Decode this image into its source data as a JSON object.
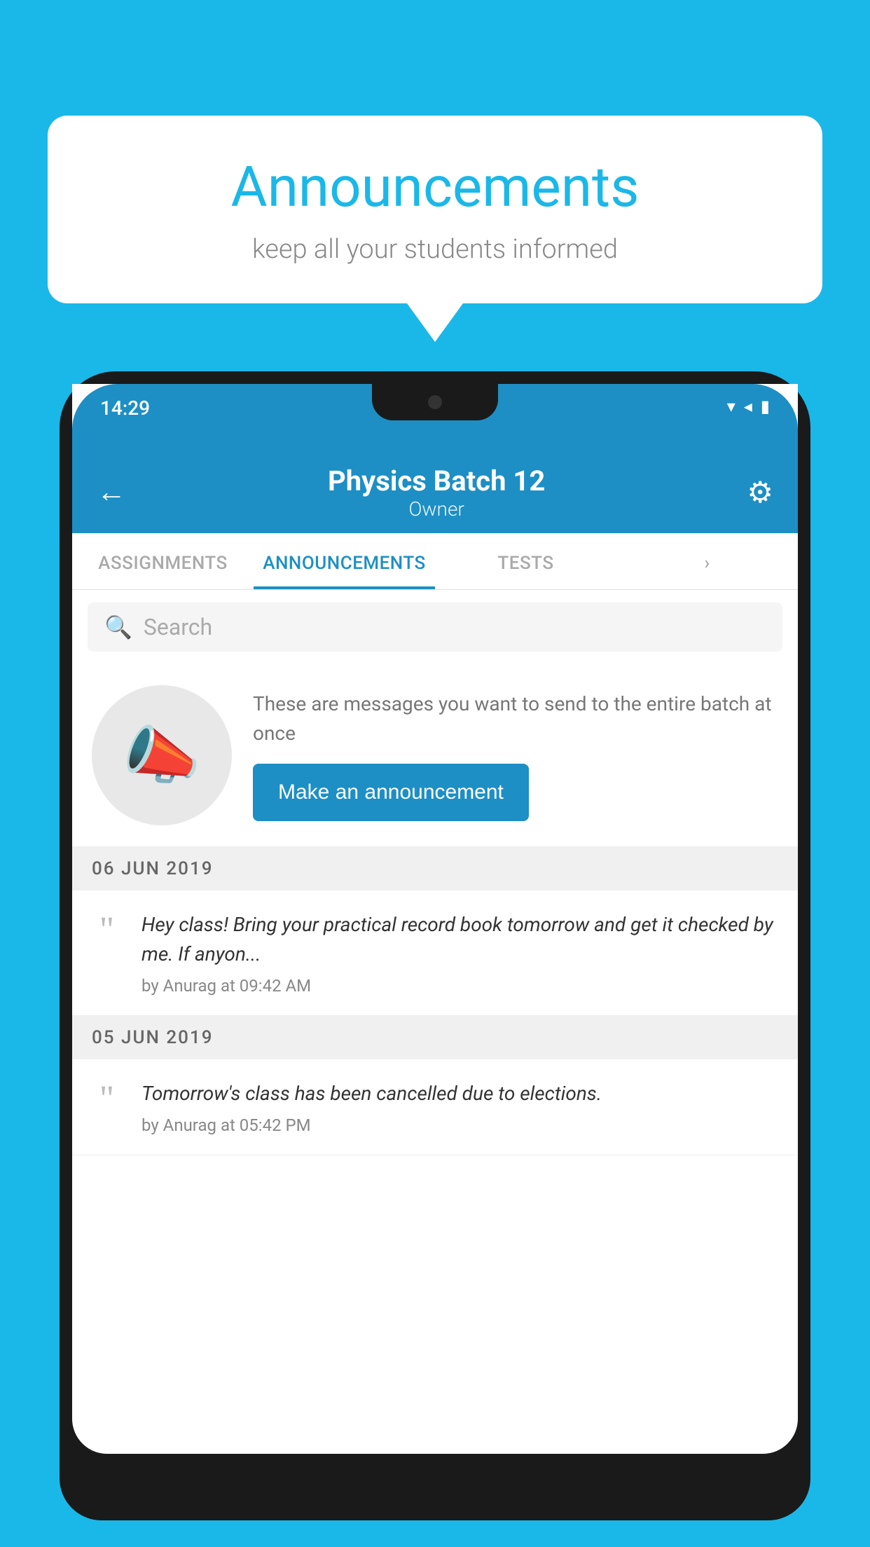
{
  "background_color": "#1ab8e8",
  "speech_bubble": {
    "title": "Announcements",
    "subtitle": "keep all your students informed"
  },
  "status_bar": {
    "time": "14:29",
    "icons": [
      "▼",
      "◀",
      "▮"
    ]
  },
  "header": {
    "back_label": "←",
    "title": "Physics Batch 12",
    "subtitle": "Owner",
    "gear_icon": "⚙"
  },
  "tabs": [
    {
      "label": "ASSIGNMENTS",
      "active": false
    },
    {
      "label": "ANNOUNCEMENTS",
      "active": true
    },
    {
      "label": "TESTS",
      "active": false
    },
    {
      "label": "",
      "active": false
    }
  ],
  "search": {
    "placeholder": "Search"
  },
  "announcement_prompt": {
    "description": "These are messages you want to send to the entire batch at once",
    "button_label": "Make an announcement"
  },
  "announcements": [
    {
      "date": "06  JUN  2019",
      "text": "Hey class! Bring your practical record book tomorrow and get it checked by me. If anyon...",
      "meta": "by Anurag at 09:42 AM"
    },
    {
      "date": "05  JUN  2019",
      "text": "Tomorrow's class has been cancelled due to elections.",
      "meta": "by Anurag at 05:42 PM"
    }
  ]
}
